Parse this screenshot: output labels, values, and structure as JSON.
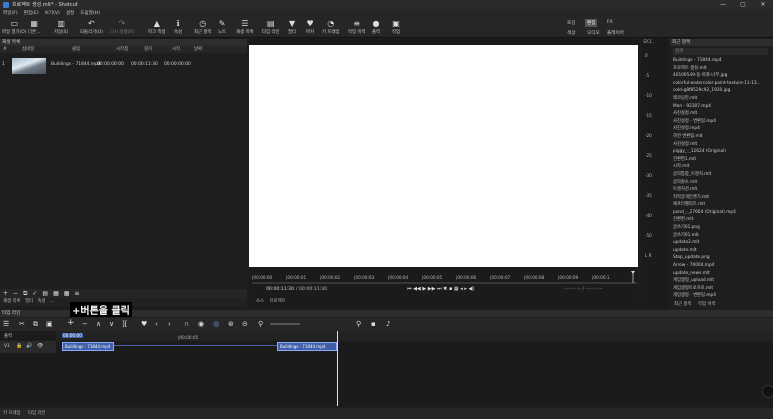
{
  "window": {
    "title": "프로젝트 생성.mlt* - Shotcut",
    "controls": [
      "—",
      "▢",
      "✕"
    ]
  },
  "menu": [
    "파일(F)",
    "편집(E)",
    "보기(V)",
    "설정",
    "도움말(H)"
  ],
  "toolbar": [
    {
      "name": "open-file",
      "label": "파일 열기(O)",
      "glyph": "▭"
    },
    {
      "name": "open-other",
      "label": "다른...",
      "glyph": "▦"
    },
    {
      "name": "save",
      "label": "저장(S)",
      "glyph": "▥"
    },
    {
      "name": "undo",
      "label": "되돌리기(U)",
      "glyph": "↶"
    },
    {
      "name": "redo",
      "label": "다시 실행(R)",
      "glyph": "↷",
      "disabled": true
    },
    {
      "name": "peak-meter",
      "label": "피크 측정",
      "glyph": "▲"
    },
    {
      "name": "properties",
      "label": "속성",
      "glyph": "ℹ"
    },
    {
      "name": "recent",
      "label": "최근 항목",
      "glyph": "◷"
    },
    {
      "name": "notes",
      "label": "노트",
      "glyph": "✎"
    },
    {
      "name": "playlist",
      "label": "재생 목록",
      "glyph": "☰"
    },
    {
      "name": "timeline",
      "label": "타임 라인",
      "glyph": "▤"
    },
    {
      "name": "filters",
      "label": "필터",
      "glyph": "▼"
    },
    {
      "name": "markers",
      "label": "마커",
      "glyph": "♥"
    },
    {
      "name": "keyframes",
      "label": "키 프레임",
      "glyph": "◔"
    },
    {
      "name": "jobs",
      "label": "작업 이력",
      "glyph": "≡"
    },
    {
      "name": "export",
      "label": "출력",
      "glyph": "●"
    },
    {
      "name": "jobs2",
      "label": "작업",
      "glyph": "▣"
    }
  ],
  "layouts": {
    "top": [
      "로깅",
      "편집",
      "FX"
    ],
    "bottom": [
      "색상",
      "오디오",
      "플레이어"
    ],
    "active": "편집"
  },
  "playlist": {
    "title": "재생 목록",
    "columns": [
      "#",
      "섬네일",
      "클립",
      "시작점",
      "길이",
      "시작",
      "날짜"
    ],
    "rows": [
      {
        "index": "1",
        "clip": "Buildings - 71844.mp4",
        "in": "00:00:00:00",
        "duration": "00:00:11:30",
        "start": "00:00:00:00"
      }
    ],
    "tools": [
      "+",
      "−",
      "⧉",
      "✓",
      "▤",
      "▦",
      "▦",
      "≡"
    ]
  },
  "dock_tabs": [
    "재생 목록",
    "필터",
    "속성",
    "..."
  ],
  "viewer": {
    "timecode": "00:00:11:30",
    "total": "/ 00:00:11:30",
    "ticks": [
      "|00:00:00",
      "|00:00:01",
      "|00:00:02",
      "|00:00:03",
      "|00:00:04",
      "|00:00:05",
      "|00:00:06",
      "|00:00:07",
      "|00:00:08",
      "|00:00:09",
      "|00:00:1"
    ],
    "transport": "⏮ ◀◀ ▶ ▶▶ ⏭ ✖ ▪ ▦ ◂ ▸ ◀)",
    "in_out": "--:--:--:--  /  --:--:--:--",
    "tabs": [
      "소스",
      "프로젝트"
    ]
  },
  "meter": {
    "title": "오디..",
    "labels": [
      "0",
      "-5",
      "-10",
      "-15",
      "-20",
      "-25",
      "-30",
      "-35",
      "-40",
      "-50",
      "L  R"
    ]
  },
  "recent": {
    "title": "최근 항목",
    "search": "검색",
    "items": [
      "Buildings - 71844.mp4",
      "프로젝트 생성.mlt",
      "40109549-동-북화-나무.jpg",
      "colorful-watercolor-paint-texture-11-13...",
      "cold-g8f8529c92_1920.jpg",
      "레코딩만.mlt",
      "Man - 92307.mp4",
      "사진설정.mlt",
      "사진설정 - 변환됨.mp4",
      "사진설정.mp4",
      "하얀 변환됨.mlt",
      "사진설정.mlt",
      "piggy_-_12624 (Original)",
      "전환편1.mlt",
      "시작.mlt",
      "글자통합_트랜지.mlt",
      "글자원소.mlt",
      "트랜지션.mlt",
      "직막글개인맨기.mlt",
      "애프터펠리트.mlt",
      "pond_-_27664 (Original).mp4",
      "전환편.mlt",
      "글쓰기01.png",
      "글쓰기01.mlt",
      "update2.mlt",
      "update.mlt",
      "Stop_update.png",
      "Arrow - 70004.mp4",
      "update_news.mlt",
      "게임생정_upload.mlt",
      "게임생정트로프로.mlt",
      "게임생정 - 변환됨.mp4"
    ],
    "tabs": [
      "최근 항목",
      "작업 이력"
    ]
  },
  "timeline": {
    "title": "타임 라인",
    "ruler_start": "00:00:00",
    "ruler_mid": "|00:00:05",
    "track_label": "V1",
    "output_label": "출력",
    "clip1": "Buildings - 71844.mp4",
    "clip2": "Buildings - 71844.mp4"
  },
  "callout": "+버튼을 클릭",
  "status": [
    "키 프레임",
    "타임 라인"
  ]
}
